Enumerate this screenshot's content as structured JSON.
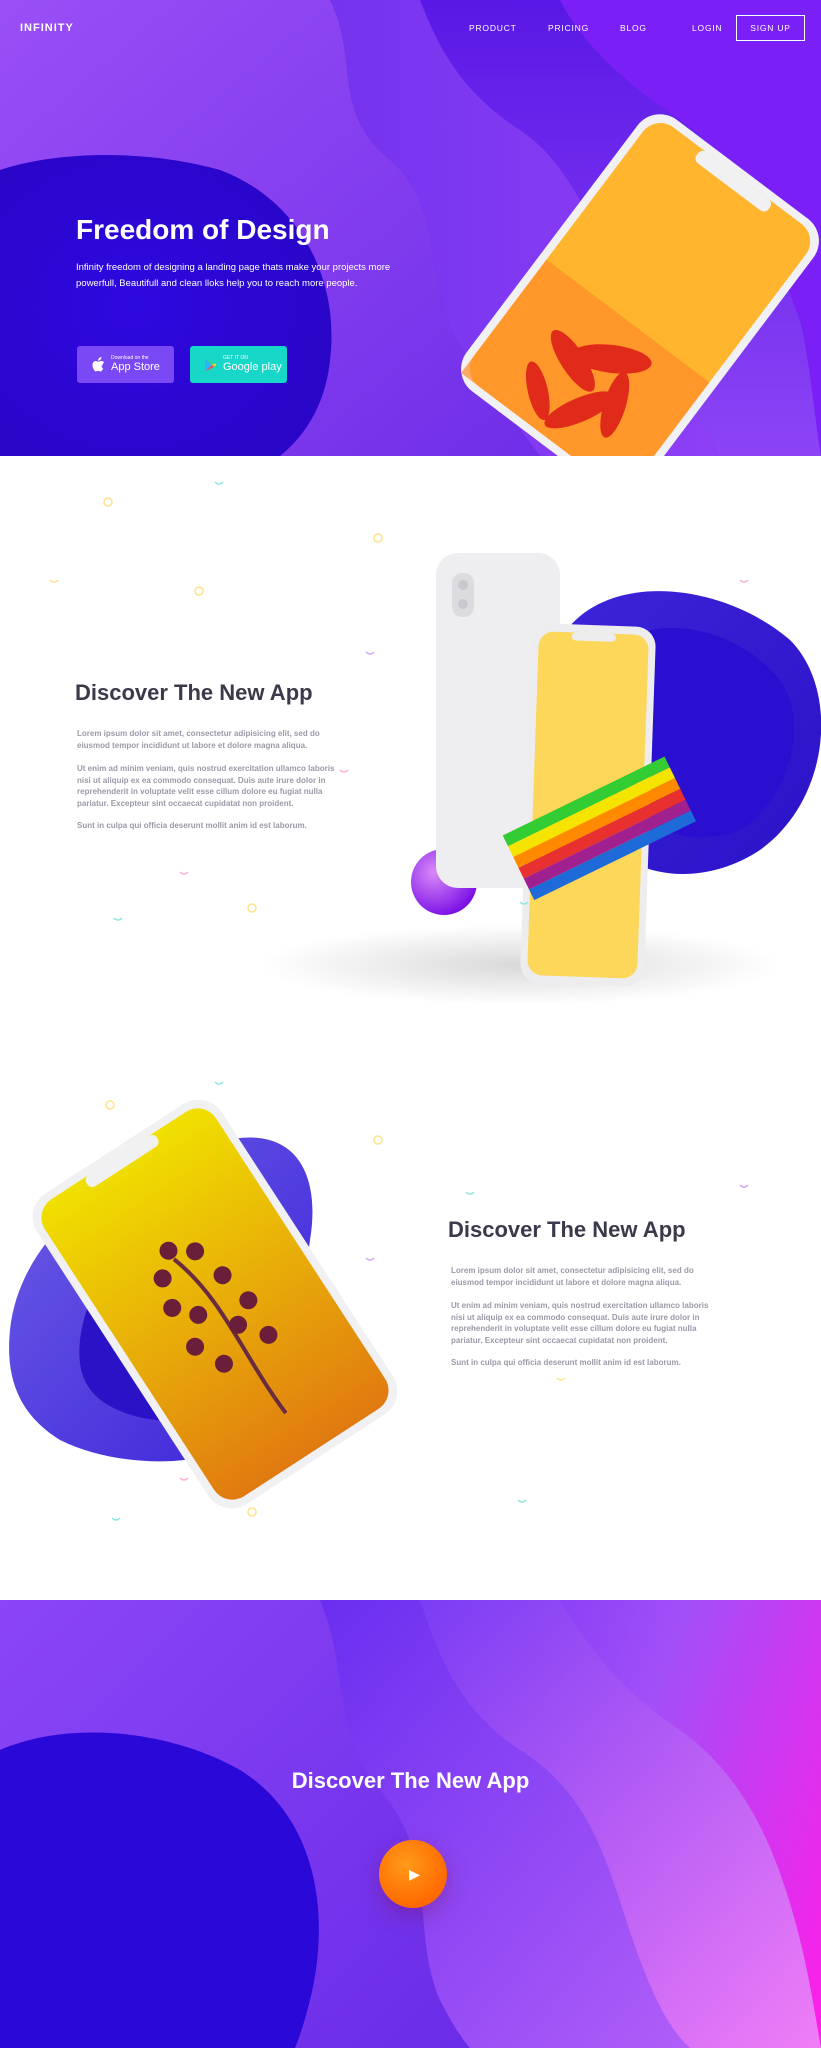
{
  "nav": {
    "logo": "INFINITY",
    "links": [
      "PRODUCT",
      "PRICING",
      "BLOG"
    ],
    "login": "LOGIN",
    "signup": "SIGN UP"
  },
  "hero": {
    "title": "Freedom of Design",
    "description": "Infinity freedom of designing a landing page thats make your projects more powerfull, Beautifull and  clean lloks help you to reach more people.",
    "app_store": {
      "small": "Download on the",
      "big": "App Store",
      "icon": "apple-icon"
    },
    "google_play": {
      "small": "GET IT ON",
      "big": "Google play",
      "icon": "google-play-icon"
    }
  },
  "section1": {
    "title": "Discover The New App",
    "paragraphs": [
      "Lorem ipsum dolor sit amet, consectetur adipisicing elit, sed do eiusmod tempor incididunt ut labore et dolore magna aliqua.",
      "Ut enim ad minim veniam, quis nostrud exercitation ullamco laboris nisi ut aliquip ex ea commodo consequat. Duis aute irure dolor in reprehenderit in voluptate velit esse cillum dolore eu fugiat nulla pariatur. Excepteur sint occaecat cupidatat non proident.",
      "Sunt in culpa qui officia deserunt mollit anim id est laborum."
    ]
  },
  "section2": {
    "title": "Discover The New App",
    "paragraphs": [
      "Lorem ipsum dolor sit amet, consectetur adipisicing elit, sed do eiusmod tempor incididunt ut labore et dolore magna aliqua.",
      "Ut enim ad minim veniam, quis nostrud exercitation ullamco laboris nisi ut aliquip ex ea commodo consequat. Duis aute irure dolor in reprehenderit in voluptate velit esse cillum dolore eu fugiat nulla pariatur. Excepteur sint occaecat cupidatat non proident.",
      "Sunt in culpa qui officia deserunt mollit anim id est laborum."
    ]
  },
  "video": {
    "title": "Discover The New App",
    "play_icon": "play-icon"
  },
  "colors": {
    "hero_purple": "#6a2cf0",
    "deep_blue": "#3b10e8",
    "teal": "#16d7c8",
    "orange": "#ff6a00",
    "magenta": "#ff1ee8"
  }
}
